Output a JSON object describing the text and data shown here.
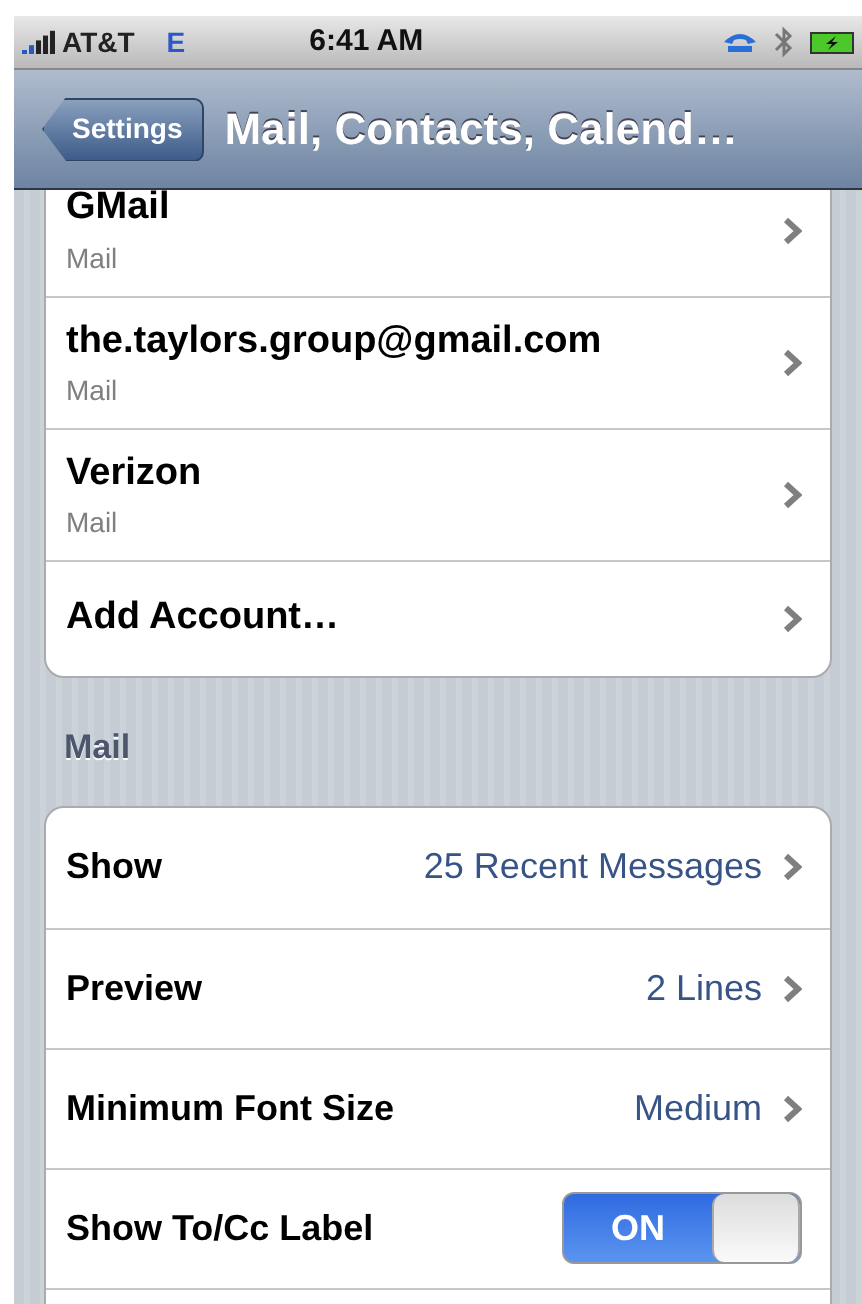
{
  "status_bar": {
    "carrier": "AT&T",
    "network": "E",
    "time": "6:41 AM"
  },
  "nav_bar": {
    "back": "Settings",
    "title": "Mail, Contacts, Calend…"
  },
  "accounts": [
    {
      "name": "GMail",
      "detail": "Mail"
    },
    {
      "name": "the.taylors.group@gmail.com",
      "detail": "Mail"
    },
    {
      "name": "Verizon",
      "detail": "Mail"
    },
    {
      "name": "Add Account…"
    }
  ],
  "mail_section": {
    "header": "Mail",
    "rows": [
      {
        "kind": "value",
        "label": "Show",
        "value": "25 Recent Messages"
      },
      {
        "kind": "value",
        "label": "Preview",
        "value": "2 Lines"
      },
      {
        "kind": "value",
        "label": "Minimum Font Size",
        "value": "Medium"
      },
      {
        "kind": "toggle",
        "label": "Show To/Cc Label",
        "on": true,
        "toggle_label": "ON"
      }
    ]
  }
}
